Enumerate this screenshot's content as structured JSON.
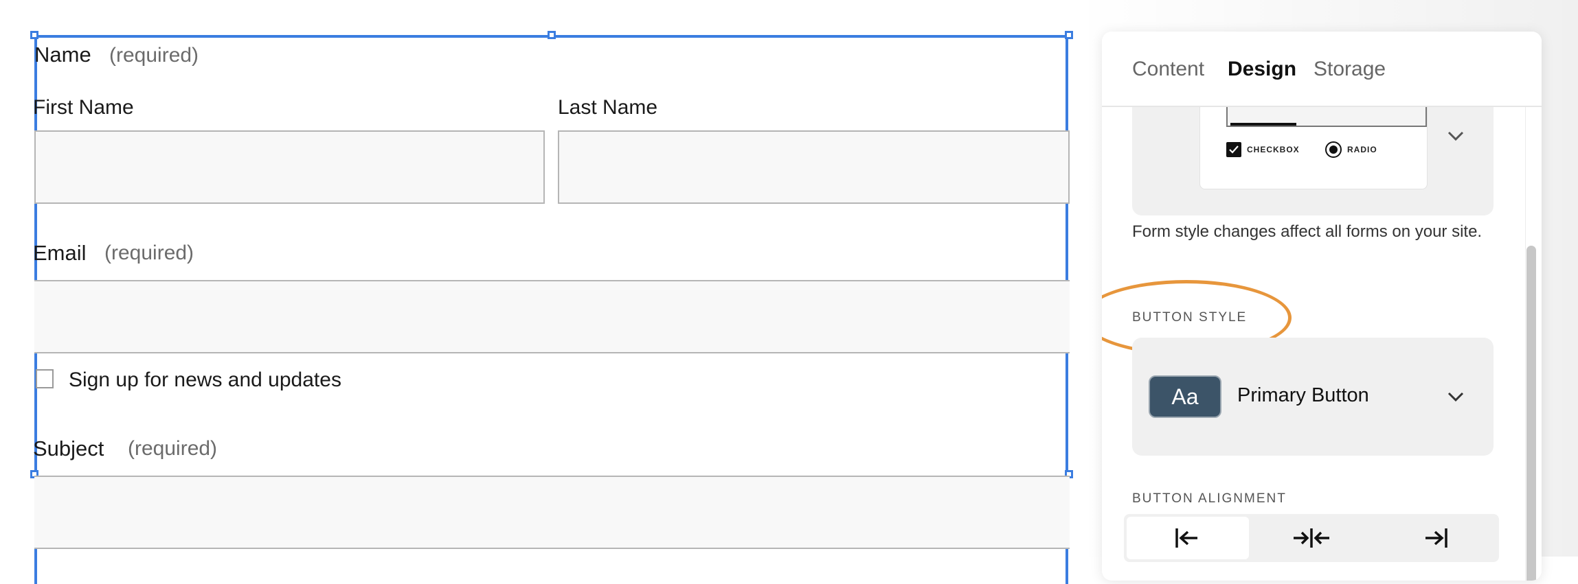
{
  "form": {
    "name_label": "Name",
    "name_required": "(required)",
    "first_name_label": "First Name",
    "last_name_label": "Last Name",
    "email_label": "Email",
    "email_required": "(required)",
    "newsletter_label": "Sign up for news and updates",
    "subject_label": "Subject",
    "subject_required": "(required)"
  },
  "panel": {
    "tabs": [
      {
        "label": "Content",
        "active": false
      },
      {
        "label": "Design",
        "active": true
      },
      {
        "label": "Storage",
        "active": false
      }
    ],
    "form_style_preview": {
      "checkbox_label": "CHECKBOX",
      "radio_label": "RADIO"
    },
    "form_style_note": "Form style changes affect all forms on your site.",
    "button_style": {
      "title": "BUTTON STYLE",
      "swatch_text": "Aa",
      "selected": "Primary Button",
      "swatch_color": "#3c5468"
    },
    "button_alignment": {
      "title": "BUTTON ALIGNMENT",
      "options": [
        "left",
        "center",
        "right"
      ],
      "selected": "left"
    }
  },
  "colors": {
    "selection": "#3b7de0",
    "highlight_ring": "#e7963c"
  }
}
